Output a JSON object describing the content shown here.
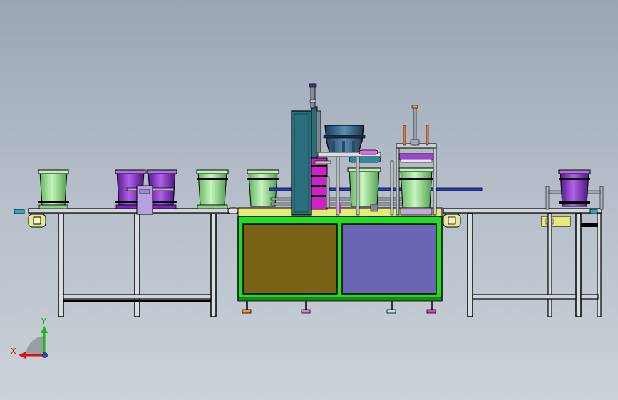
{
  "triad": {
    "x_label": "X",
    "y_label": "Y"
  },
  "colors": {
    "frame_green": "#22dd22",
    "panel_olive": "#7a6216",
    "panel_violet": "#6a66b4",
    "bucket_green": "#8ee08a",
    "bucket_purple": "#8a2ac8",
    "machine_teal": "#2c6e7c",
    "hopper_blue": "#3a6c94",
    "magenta": "#d020c8",
    "conveyor_blue": "#3044c8",
    "stand_gray": "#9aa4ae",
    "accent_yellow": "#e8e87a"
  }
}
